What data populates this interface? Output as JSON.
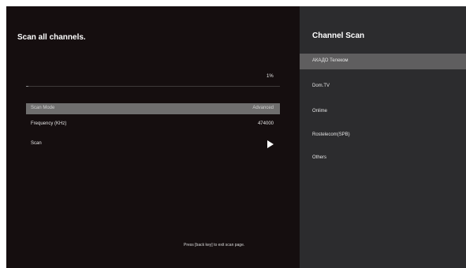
{
  "left_panel": {
    "title": "Scan all channels.",
    "progress": {
      "value_text": "1%",
      "percent": 1
    },
    "settings": [
      {
        "label": "Scan Mode",
        "value": "Advanced",
        "selected": true
      },
      {
        "label": "Frequency (KHz)",
        "value": "474000",
        "selected": false
      },
      {
        "label": "Scan",
        "icon": "play-icon",
        "selected": false
      }
    ],
    "hint": "Press [back key] to exit scan page."
  },
  "right_panel": {
    "title": "Channel Scan",
    "items": [
      {
        "label": "АКАДО Телеком",
        "selected": true
      },
      {
        "label": "Dom.TV",
        "selected": false
      },
      {
        "label": "Onlime",
        "selected": false
      },
      {
        "label": "Rostelecom(SPB)",
        "selected": false
      },
      {
        "label": "Others",
        "selected": false
      }
    ]
  },
  "colors": {
    "background": "#150e0f",
    "side_panel": "#2c2c2e",
    "selected_row": "#6f6e6e",
    "text": "#ffffff"
  }
}
